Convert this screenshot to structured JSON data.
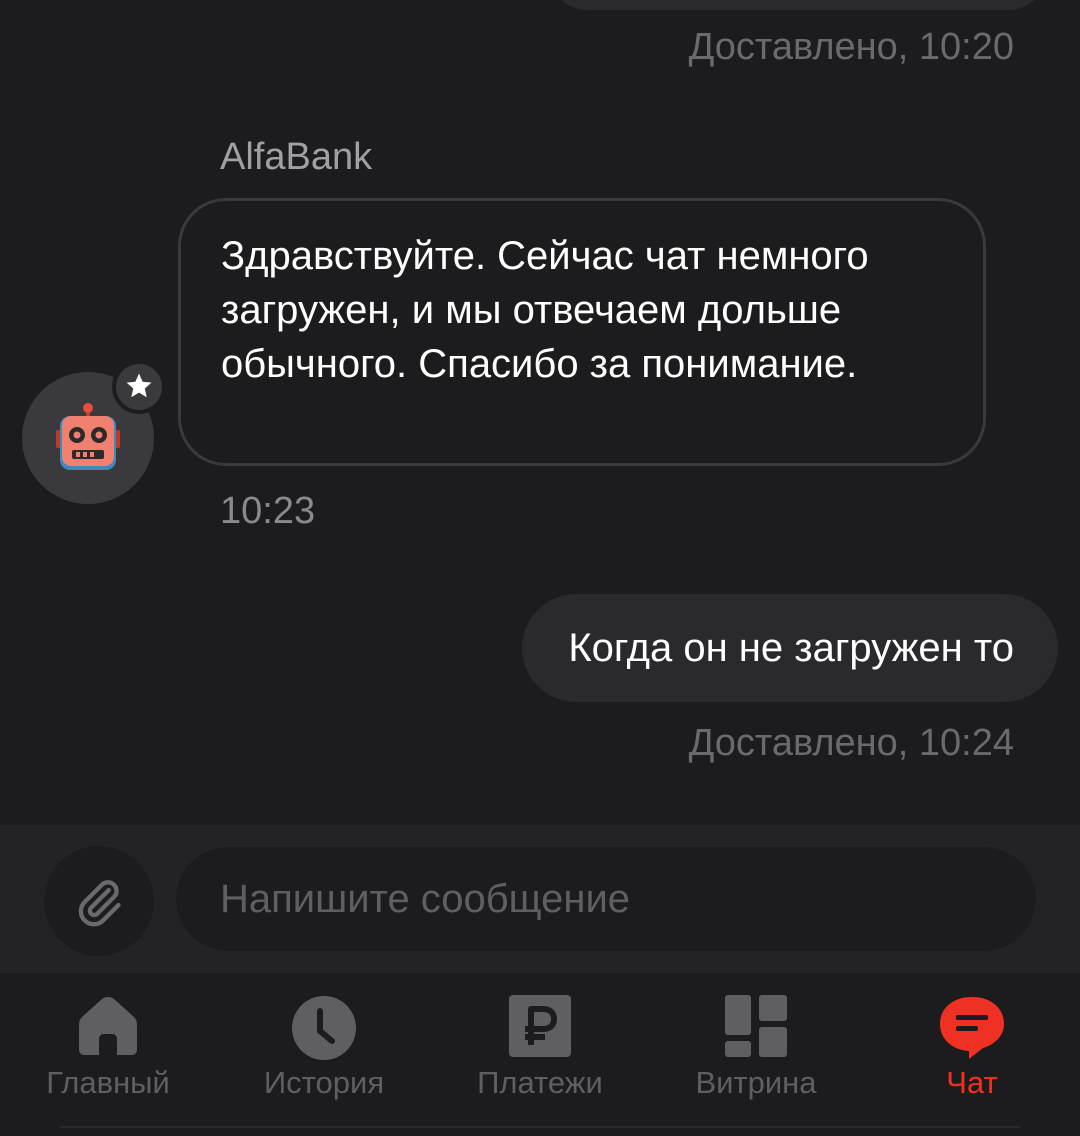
{
  "chat": {
    "status_top": "Доставлено, 10:20",
    "sender_name": "AlfaBank",
    "incoming_message": "Здравствуйте. Сейчас чат немного загружен, и мы отвечаем дольше обычного. Спасибо за понимание.",
    "incoming_time": "10:23",
    "outgoing_message": "Когда он не загружен то",
    "outgoing_status": "Доставлено, 10:24"
  },
  "composer": {
    "placeholder": "Напишите сообщение"
  },
  "tabs": [
    {
      "label": "Главный",
      "icon": "home-icon"
    },
    {
      "label": "История",
      "icon": "clock-icon"
    },
    {
      "label": "Платежи",
      "icon": "ruble-icon"
    },
    {
      "label": "Витрина",
      "icon": "showcase-icon"
    },
    {
      "label": "Чат",
      "icon": "chat-icon",
      "active": true
    }
  ],
  "colors": {
    "accent": "#ef3124",
    "background": "#1c1c1e",
    "bubble": "#2a2a2e",
    "muted_text": "#5f5f63"
  }
}
